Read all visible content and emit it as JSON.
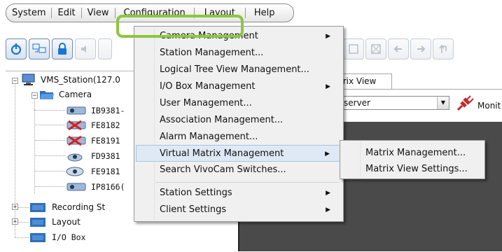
{
  "menubar": {
    "items": [
      {
        "label": "System"
      },
      {
        "label": "Edit"
      },
      {
        "label": "View"
      },
      {
        "label": "Configuration"
      },
      {
        "label": "Layout"
      },
      {
        "label": "Help"
      }
    ]
  },
  "tree": {
    "station": "VMS_Station(127.0",
    "camera_folder": "Camera",
    "cameras": [
      "IB9381-",
      "FE8182",
      "FE8191",
      "FD9381",
      "FE9181",
      "IP8166("
    ],
    "recording": "Recording St",
    "layout": "Layout",
    "io_box": "I/O Box"
  },
  "right": {
    "tab_label": "trix View",
    "server_value": "server",
    "monitor_label": "Monit"
  },
  "config_menu": {
    "items": [
      {
        "label": "Camera Management",
        "submenu": true
      },
      {
        "label": "Station Management...",
        "submenu": false
      },
      {
        "label": "Logical Tree View Management...",
        "submenu": false
      },
      {
        "label": "I/O Box Management",
        "submenu": true
      },
      {
        "label": "User Management...",
        "submenu": false
      },
      {
        "label": "Association Management...",
        "submenu": false
      },
      {
        "label": "Alarm Management...",
        "submenu": false
      },
      {
        "label": "Virtual Matrix Management",
        "submenu": true
      },
      {
        "label": "Search VivoCam Switches...",
        "submenu": false
      },
      {
        "label": "Station Settings",
        "submenu": true
      },
      {
        "label": "Client Settings",
        "submenu": true
      }
    ]
  },
  "virtual_matrix_submenu": {
    "items": [
      {
        "label": "Matrix Management..."
      },
      {
        "label": "Matrix View Settings..."
      }
    ]
  },
  "colors": {
    "highlight": "#8cc63f",
    "toolbar_accent": "#1976d2",
    "active_item_bg": "#dfe9f5"
  }
}
